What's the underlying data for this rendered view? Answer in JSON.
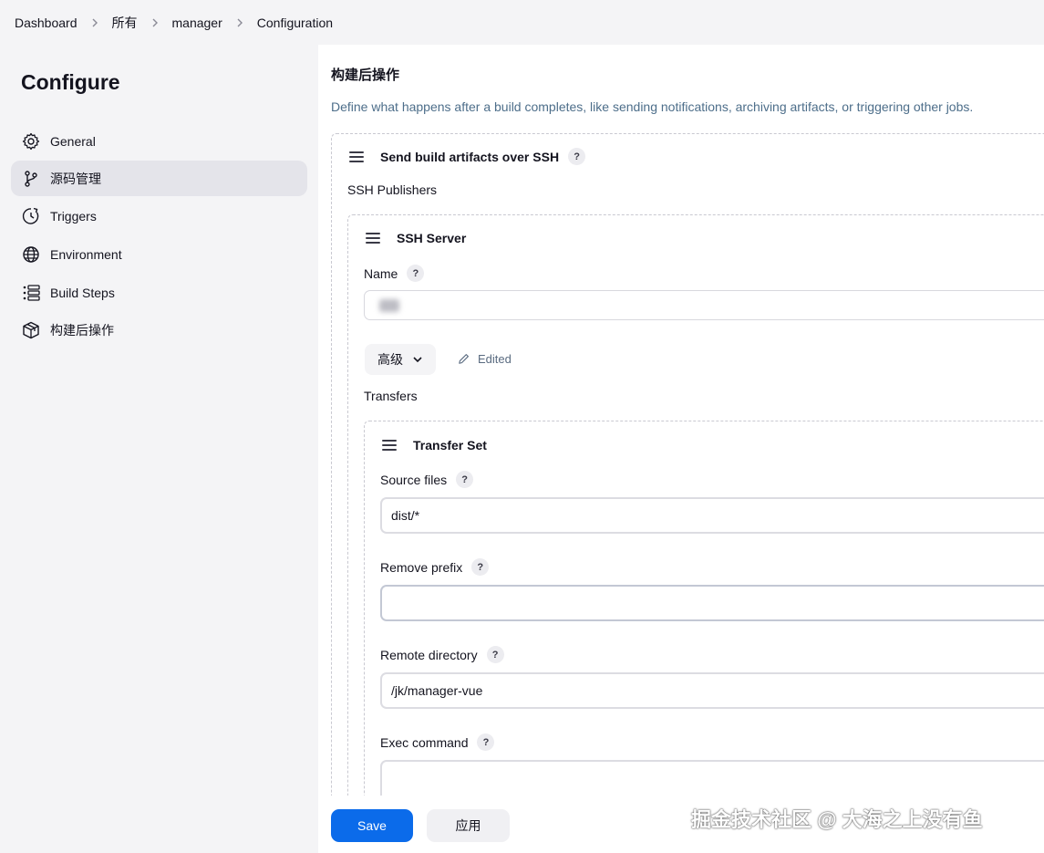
{
  "breadcrumb": [
    {
      "label": "Dashboard"
    },
    {
      "label": "所有"
    },
    {
      "label": "manager"
    },
    {
      "label": "Configuration"
    }
  ],
  "sidebar": {
    "title": "Configure",
    "items": [
      {
        "label": "General",
        "icon": "gear-icon",
        "active": false
      },
      {
        "label": "源码管理",
        "icon": "branch-icon",
        "active": true
      },
      {
        "label": "Triggers",
        "icon": "clock-icon",
        "active": false
      },
      {
        "label": "Environment",
        "icon": "globe-icon",
        "active": false
      },
      {
        "label": "Build Steps",
        "icon": "list-icon",
        "active": false
      },
      {
        "label": "构建后操作",
        "icon": "package-icon",
        "active": false
      }
    ]
  },
  "main": {
    "section_title": "构建后操作",
    "section_desc": "Define what happens after a build completes, like sending notifications, archiving artifacts, or triggering other jobs.",
    "publisher": {
      "title": "Send build artifacts over SSH",
      "help": "?",
      "publishers_label": "SSH Publishers",
      "server": {
        "title": "SSH Server",
        "name_label": "Name",
        "name_help": "?",
        "name_value": "",
        "advanced_label": "高级",
        "edited_label": "Edited",
        "transfers_label": "Transfers",
        "transfer_set": {
          "title": "Transfer Set",
          "source_files_label": "Source files",
          "source_files_value": "dist/*",
          "remove_prefix_label": "Remove prefix",
          "remove_prefix_value": "",
          "remote_directory_label": "Remote directory",
          "remote_directory_value": "/jk/manager-vue",
          "exec_command_label": "Exec command",
          "exec_command_value": "",
          "help": "?"
        }
      }
    }
  },
  "footer": {
    "save_label": "Save",
    "apply_label": "应用"
  },
  "watermark": "掘金技术社区 @ 大海之上没有鱼",
  "colors": {
    "primary": "#0b6bea",
    "sidebar_bg": "#f4f4f6",
    "active_item_bg": "#e4e4ea",
    "desc_text": "#4d6e8a"
  }
}
